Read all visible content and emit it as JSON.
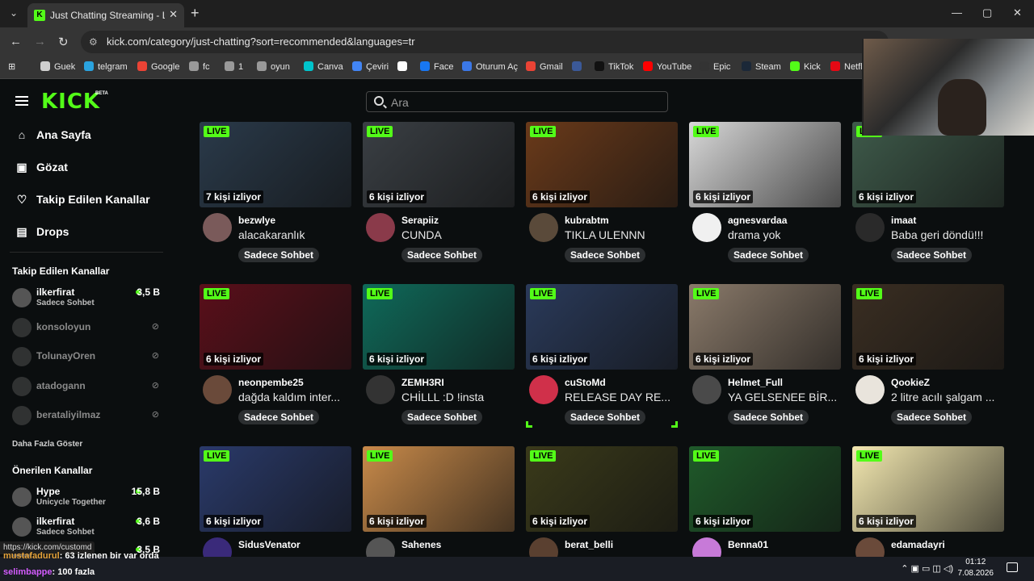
{
  "browser": {
    "tab_title": "Just Chatting Streaming - Live S",
    "url": "kick.com/category/just-chatting?sort=recommended&languages=tr",
    "bookmarks": [
      {
        "label": "Guek",
        "color": "#cfcfcf"
      },
      {
        "label": "telgram",
        "color": "#2aa3df"
      },
      {
        "label": "Google",
        "color": "#ea4335"
      },
      {
        "label": "fc",
        "color": "#999"
      },
      {
        "label": "1",
        "color": "#999"
      },
      {
        "label": "oyun",
        "color": "#999"
      },
      {
        "label": "Canva",
        "color": "#00c4cc"
      },
      {
        "label": "Çeviri",
        "color": "#4285f4"
      },
      {
        "label": "",
        "color": "#ffffff"
      },
      {
        "label": "Face",
        "color": "#1877f2"
      },
      {
        "label": "Oturum Aç",
        "color": "#3b78e7"
      },
      {
        "label": "Gmail",
        "color": "#ea4335"
      },
      {
        "label": "",
        "color": "#3b5998"
      },
      {
        "label": "TikTok",
        "color": "#111"
      },
      {
        "label": "YouTube",
        "color": "#ff0000"
      },
      {
        "label": "Epic",
        "color": "#333"
      },
      {
        "label": "Steam",
        "color": "#1b2838"
      },
      {
        "label": "Kick",
        "color": "#53fc18"
      },
      {
        "label": "Netfl",
        "color": "#e50914"
      }
    ]
  },
  "header": {
    "logo": "KICK",
    "logo_badge": "BETA",
    "search_placeholder": "Ara"
  },
  "sidebar": {
    "nav": [
      {
        "label": "Ana Sayfa",
        "icon": "home-icon",
        "glyph": "⌂"
      },
      {
        "label": "Gözat",
        "icon": "browse-icon",
        "glyph": "▣"
      },
      {
        "label": "Takip Edilen Kanallar",
        "icon": "heart-icon",
        "glyph": "♡"
      },
      {
        "label": "Drops",
        "icon": "drops-icon",
        "glyph": "▤"
      }
    ],
    "followed_heading": "Takip Edilen Kanallar",
    "followed": [
      {
        "name": "ilkerfirat",
        "sub": "Sadece Sohbet",
        "count": "3,5 B",
        "live": true
      },
      {
        "name": "konsoloyun",
        "live": false
      },
      {
        "name": "TolunayOren",
        "live": false
      },
      {
        "name": "atadogann",
        "live": false
      },
      {
        "name": "berataliyilmaz",
        "live": false
      }
    ],
    "show_more": "Daha Fazla Göster",
    "recommended_heading": "Önerilen Kanallar",
    "recommended": [
      {
        "name": "Hype",
        "sub": "Unicycle Together",
        "count": "15,8 B"
      },
      {
        "name": "ilkerfirat",
        "sub": "Sadece Sohbet",
        "count": "3,6 B"
      },
      {
        "name": "",
        "sub": "",
        "count": "3,5 B"
      }
    ]
  },
  "streams": [
    {
      "name": "bezwlye",
      "title": "alacakaranlık",
      "viewers": "7 kişi izliyor",
      "tag": "Sadece Sohbet",
      "live": "LIVE",
      "bg": "#2a3a4a",
      "av": "#7a5a5a"
    },
    {
      "name": "Serapiiz",
      "title": "CUNDA",
      "viewers": "6 kişi izliyor",
      "tag": "Sadece Sohbet",
      "live": "LIVE",
      "bg": "#3a3f44",
      "av": "#8a3a4a"
    },
    {
      "name": "kubrabtm",
      "title": "TIKLA ULENNN",
      "viewers": "6 kişi izliyor",
      "tag": "Sadece Sohbet",
      "live": "LIVE",
      "bg": "#6a3a1a",
      "av": "#5a4a3a"
    },
    {
      "name": "agnesvardaa",
      "title": "drama yok",
      "viewers": "6 kişi izliyor",
      "tag": "Sadece Sohbet",
      "live": "LIVE",
      "bg": "#d8d8d8",
      "av": "#f0f0f0"
    },
    {
      "name": "imaat",
      "title": "Baba geri döndü!!!",
      "viewers": "6 kişi izliyor",
      "tag": "Sadece Sohbet",
      "live": "LIVE",
      "bg": "#3e5a4a",
      "av": "#2a2a2a"
    },
    {
      "name": "neonpembe25",
      "title": "dağda kaldım inter...",
      "viewers": "6 kişi izliyor",
      "tag": "Sadece Sohbet",
      "live": "LIVE",
      "bg": "#5a0f1a",
      "av": "#6a4a3a"
    },
    {
      "name": "ZEMH3RI",
      "title": "CHİLLL :D !insta",
      "viewers": "6 kişi izliyor",
      "tag": "Sadece Sohbet",
      "live": "LIVE",
      "bg": "#0f6a5a",
      "av": "#333"
    },
    {
      "name": "cuStoMd",
      "title": "RELEASE DAY RE...",
      "viewers": "6 kişi izliyor",
      "tag": "Sadece Sohbet",
      "live": "LIVE",
      "bg": "#2a3a5a",
      "av": "#d0304a"
    },
    {
      "name": "Helmet_Full",
      "title": "YA GELSENEE BİR...",
      "viewers": "6 kişi izliyor",
      "tag": "Sadece Sohbet",
      "live": "LIVE",
      "bg": "#8a7a6a",
      "av": "#4a4a4a"
    },
    {
      "name": "QookieZ",
      "title": "2 litre acılı şalgam ...",
      "viewers": "6 kişi izliyor",
      "tag": "Sadece Sohbet",
      "live": "LIVE",
      "bg": "#3a2e22",
      "av": "#e9e4dc"
    },
    {
      "name": "SidusVenator",
      "title": "",
      "viewers": "6 kişi izliyor",
      "tag": "",
      "live": "LIVE",
      "bg": "#2a3a6a",
      "av": "#3a2a7a"
    },
    {
      "name": "Sahenes",
      "title": "",
      "viewers": "6 kişi izliyor",
      "tag": "",
      "live": "LIVE",
      "bg": "#c88a4a",
      "av": "#555"
    },
    {
      "name": "berat_belli",
      "title": "",
      "viewers": "6 kişi izliyor",
      "tag": "",
      "live": "LIVE",
      "bg": "#3a3a1a",
      "av": "#5a4030"
    },
    {
      "name": "Benna01",
      "title": "",
      "viewers": "6 kişi izliyor",
      "tag": "",
      "live": "LIVE",
      "bg": "#1f5a2a",
      "av": "#c77ad8"
    },
    {
      "name": "edamadayri",
      "title": "",
      "viewers": "6 kişi izliyor",
      "tag": "",
      "live": "LIVE",
      "bg": "#f3e8b0",
      "av": "#6a4a3a"
    }
  ],
  "status_url": "https://kick.com/customd",
  "chat": [
    {
      "user": "mustafadurul",
      "text": ": 63 izlenen bir var orda"
    },
    {
      "user": "selimbappe",
      "text": ": 100 fazla"
    }
  ],
  "taskbar": {
    "time": "01:12",
    "date": "7.08.2026"
  }
}
